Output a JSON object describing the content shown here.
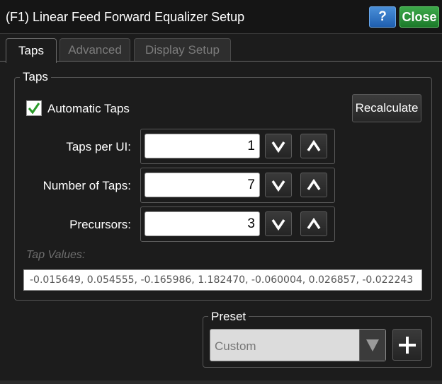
{
  "window": {
    "title": "(F1) Linear Feed Forward Equalizer Setup",
    "help_label": "?",
    "close_label": "Close"
  },
  "tabs": [
    {
      "label": "Taps",
      "active": true
    },
    {
      "label": "Advanced",
      "active": false
    },
    {
      "label": "Display Setup",
      "active": false
    }
  ],
  "taps_group": {
    "legend": "Taps",
    "automatic_taps": {
      "label": "Automatic Taps",
      "checked": true
    },
    "recalculate_label": "Recalculate",
    "fields": [
      {
        "label": "Taps per UI:",
        "value": "1"
      },
      {
        "label": "Number of Taps:",
        "value": "7"
      },
      {
        "label": "Precursors:",
        "value": "3"
      }
    ],
    "tap_values_label": "Tap Values:",
    "tap_values": "-0.015649, 0.054555, -0.165986, 1.182470, -0.060004, 0.026857, -0.022243"
  },
  "preset_group": {
    "legend": "Preset",
    "selected": "Custom"
  },
  "colors": {
    "help_button": "#2f78c8",
    "close_button": "#2a9438",
    "background": "#1c1c1c"
  },
  "icons": {
    "spin_down": "chevron-down-icon",
    "spin_up": "chevron-up-icon",
    "check": "check-icon",
    "dropdown": "triangle-down-icon",
    "add": "plus-icon"
  }
}
